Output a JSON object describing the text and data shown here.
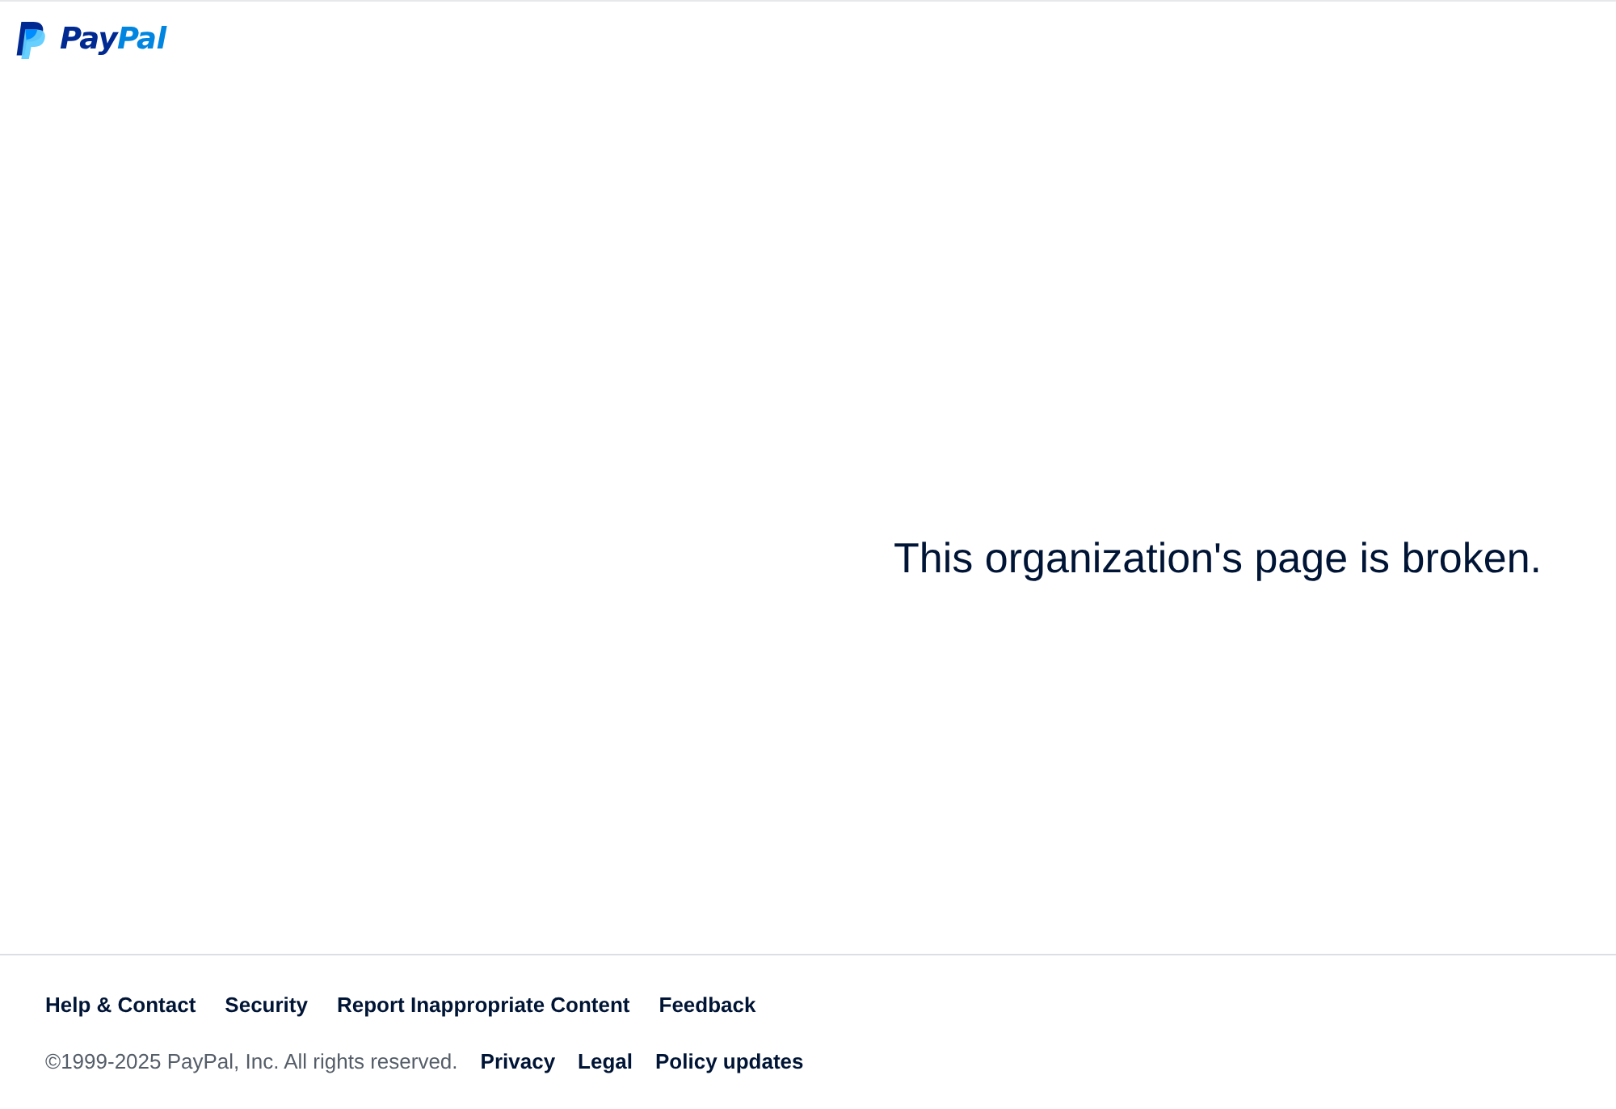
{
  "header": {
    "logo": {
      "wordmark": [
        "Pay",
        "Pal"
      ]
    }
  },
  "message": "This organization's page is broken.",
  "footer": {
    "links": [
      "Help & Contact",
      "Security",
      "Report Inappropriate Content",
      "Feedback"
    ],
    "copyright": "©1999-2025 PayPal, Inc. All rights reserved.",
    "legal_links": [
      "Privacy",
      "Legal",
      "Policy updates"
    ]
  }
}
